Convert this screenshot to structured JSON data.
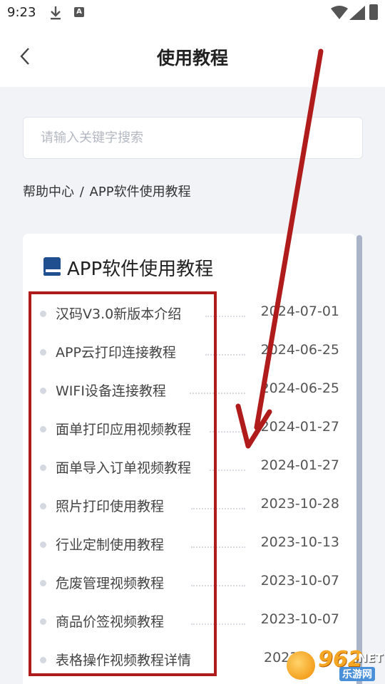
{
  "status_bar": {
    "time": "9:23",
    "download_icon": "download-icon",
    "a_badge": "A",
    "wifi_icon": "wifi-icon",
    "signal_icon": "signal-icon",
    "battery_icon": "battery-icon"
  },
  "nav": {
    "title": "使用教程",
    "back_icon": "chevron-left-icon"
  },
  "search": {
    "placeholder": "请输入关键字搜索",
    "value": ""
  },
  "breadcrumb": {
    "home": "帮助中心",
    "separator": "/",
    "current": "APP软件使用教程"
  },
  "card": {
    "icon": "book-icon",
    "title": "APP软件使用教程",
    "items": [
      {
        "title": "汉码V3.0新版本介绍",
        "date": "2024-07-01"
      },
      {
        "title": "APP云打印连接教程",
        "date": "2024-06-25"
      },
      {
        "title": "WIFI设备连接教程",
        "date": "2024-06-25"
      },
      {
        "title": "面单打印应用视频教程",
        "date": "2024-01-27"
      },
      {
        "title": "面单导入订单视频教程",
        "date": "2024-01-27"
      },
      {
        "title": "照片打印使用教程",
        "date": "2023-10-28"
      },
      {
        "title": "行业定制使用教程",
        "date": "2023-10-13"
      },
      {
        "title": "危废管理视频教程",
        "date": "2023-10-07"
      },
      {
        "title": "商品价签视频教程",
        "date": "2023-10-07"
      },
      {
        "title": "表格操作视频教程详情",
        "date": "2023-"
      }
    ]
  },
  "annotation": {
    "highlight_color": "#b01c1c",
    "arrow_color": "#b01c1c"
  },
  "watermark": {
    "number": "962",
    "suffix": ".NET",
    "cn": "乐游网"
  },
  "colors": {
    "background": "#f1f3f7",
    "card": "#ffffff",
    "bullet": "#d4d8e0",
    "scrollbar": "#a9b4c8",
    "book_icon": "#1f4f8f"
  }
}
